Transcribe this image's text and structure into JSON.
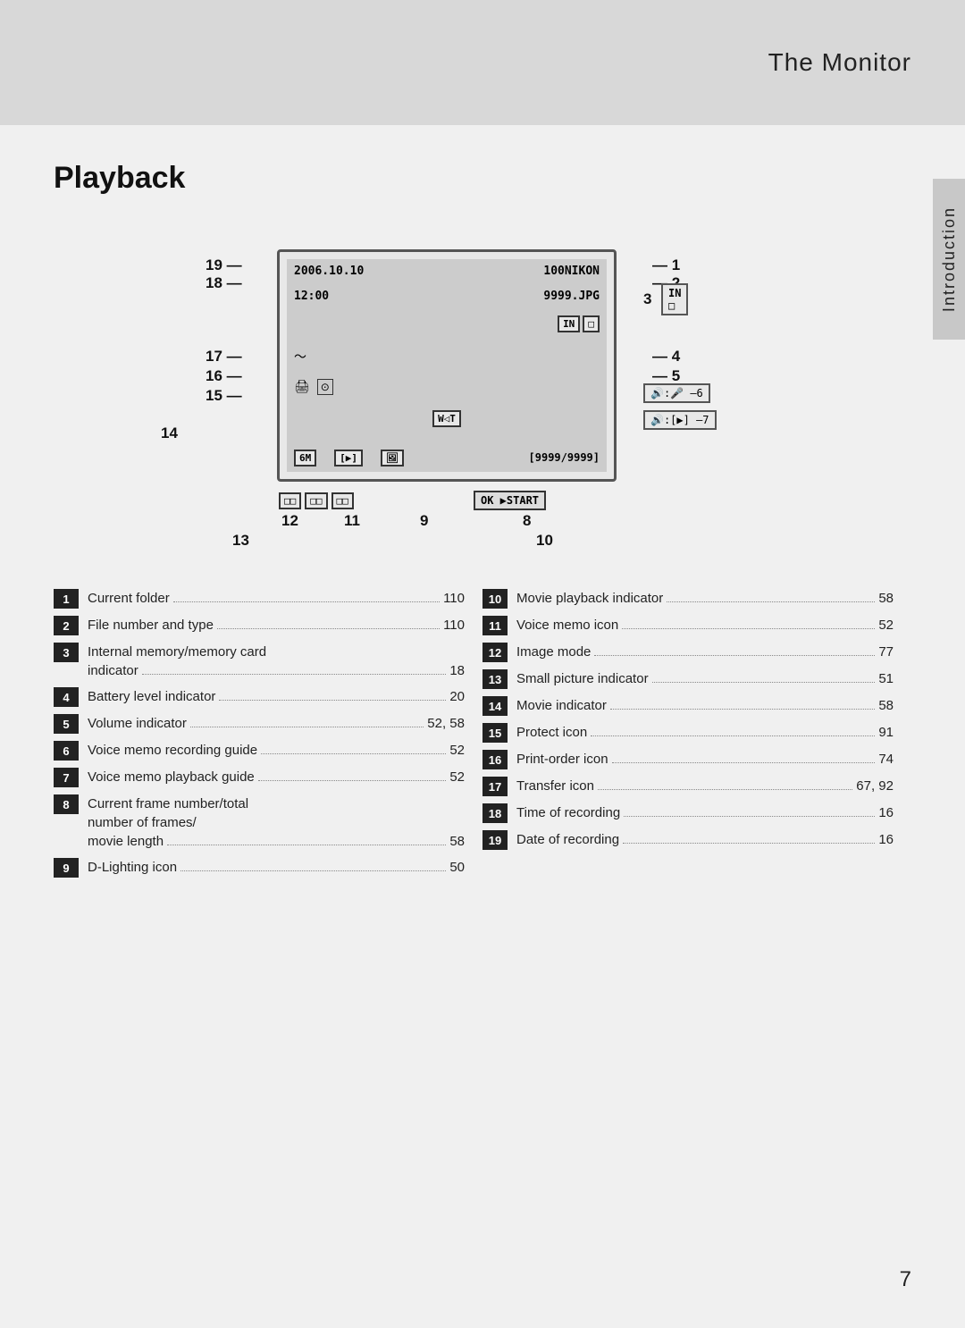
{
  "page": {
    "top_title": "The Monitor",
    "section_title": "Playback",
    "sidebar_label": "Introduction",
    "page_number": "7"
  },
  "diagram": {
    "screen": {
      "date": "2006.10.10",
      "time": "12:00",
      "folder": "100NIKON",
      "file": "9999.JPG",
      "volume": "W◁T",
      "frame": "[9999/9999]",
      "labels": {
        "n19": "19",
        "n18": "18",
        "n17": "17",
        "n16": "16",
        "n15": "15",
        "n14": "14",
        "n12": "12",
        "n11": "11",
        "n9": "9",
        "n8": "8",
        "n13": "13",
        "n10": "10",
        "n1": "1",
        "n2": "2",
        "n3": "3",
        "n4": "4",
        "n5": "5",
        "n6": "6",
        "n7": "7"
      }
    }
  },
  "items_left": [
    {
      "num": "1",
      "text": "Current folder",
      "dots": true,
      "page": "110"
    },
    {
      "num": "2",
      "text": "File number and type",
      "dots": true,
      "page": "110"
    },
    {
      "num": "3",
      "text": "Internal memory/memory card\nindicator",
      "dots": true,
      "page": "18"
    },
    {
      "num": "4",
      "text": "Battery level indicator",
      "dots": true,
      "page": "20"
    },
    {
      "num": "5",
      "text": "Volume indicator",
      "dots": true,
      "page": "52, 58"
    },
    {
      "num": "6",
      "text": "Voice memo recording guide",
      "dots": true,
      "page": "52"
    },
    {
      "num": "7",
      "text": "Voice memo playback guide",
      "dots": true,
      "page": "52"
    },
    {
      "num": "8",
      "text": "Current frame number/total\nnumber of frames/\nmovie length",
      "dots": true,
      "page": "58"
    },
    {
      "num": "9",
      "text": "D-Lighting icon",
      "dots": true,
      "page": "50"
    }
  ],
  "items_right": [
    {
      "num": "10",
      "text": "Movie playback indicator",
      "dots": true,
      "page": "58"
    },
    {
      "num": "11",
      "text": "Voice memo icon",
      "dots": true,
      "page": "52"
    },
    {
      "num": "12",
      "text": "Image mode",
      "dots": true,
      "page": "77"
    },
    {
      "num": "13",
      "text": "Small picture indicator",
      "dots": true,
      "page": "51"
    },
    {
      "num": "14",
      "text": "Movie indicator",
      "dots": true,
      "page": "58"
    },
    {
      "num": "15",
      "text": "Protect icon",
      "dots": true,
      "page": "91"
    },
    {
      "num": "16",
      "text": "Print-order icon",
      "dots": true,
      "page": "74"
    },
    {
      "num": "17",
      "text": "Transfer icon",
      "dots": true,
      "page": "67, 92"
    },
    {
      "num": "18",
      "text": "Time of recording",
      "dots": true,
      "page": "16"
    },
    {
      "num": "19",
      "text": "Date of recording",
      "dots": true,
      "page": "16"
    }
  ]
}
